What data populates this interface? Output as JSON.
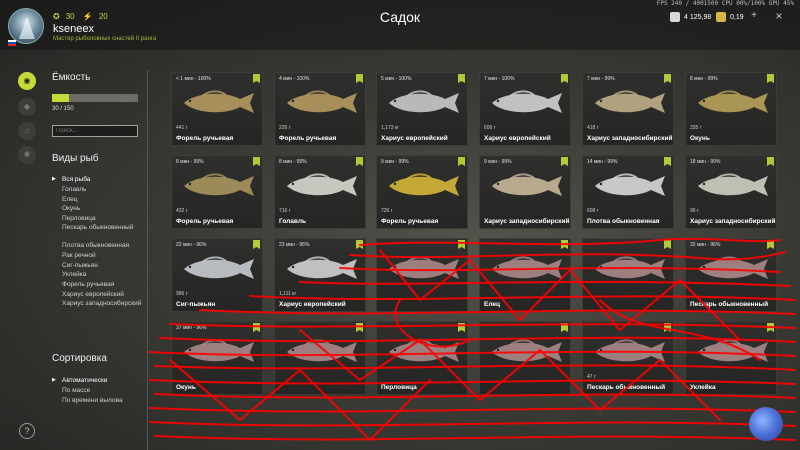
{
  "fps_overlay": "FPS 240 / 4001500 CPU 00%/100% GPU 45%",
  "user": {
    "level": "30",
    "rank": "20",
    "name": "kseneex",
    "title": "Мастер рыболовных снастей II ранга"
  },
  "page": {
    "title": "Садок"
  },
  "currency": {
    "silver": "4 125,98",
    "gold": "0,19",
    "plus": "+",
    "close": "×"
  },
  "capacity": {
    "title": "Ёмкость",
    "text": "30 / 150",
    "fill": 0.2
  },
  "search": {
    "placeholder": "Поиск..."
  },
  "species": {
    "title": "Виды рыб",
    "items": [
      "Вся рыба",
      "Голавль",
      "Елец",
      "Окунь",
      "Перловица",
      "Пескарь обыкновенный",
      "Плотва обыкновенная",
      "Рак речной",
      "Сиг-пыжьян",
      "Уклейка",
      "Форель ручьевая",
      "Хариус европейский",
      "Хариус западносибирский"
    ]
  },
  "sorting": {
    "title": "Сортировка",
    "items": [
      "Автоматически",
      "По массе",
      "По времени вылова"
    ]
  },
  "icons": {
    "rail": [
      "fish-keepnet-icon",
      "fish-icon",
      "home-icon",
      "tools-icon"
    ],
    "help": "?"
  },
  "colors": {
    "accent": "#c7d936",
    "scribble": "#ff0000"
  },
  "fish_cards": [
    {
      "tag": "< 1 мин - 100%",
      "weight": "441 г",
      "name": "Форель ручьевая",
      "color": "#b59a62"
    },
    {
      "tag": "4 мин - 100%",
      "weight": "226 г",
      "name": "Форель ручьевая",
      "color": "#b59a62"
    },
    {
      "tag": "5 мин - 100%",
      "weight": "1,173 кг",
      "name": "Хариус европейский",
      "color": "#c9c9c9"
    },
    {
      "tag": "7 мин - 100%",
      "weight": "606 г",
      "name": "Хариус европейский",
      "color": "#d2d2d2"
    },
    {
      "tag": "7 мин - 99%",
      "weight": "418 г",
      "name": "Хариус западносибирский",
      "color": "#bfae88"
    },
    {
      "tag": "8 мин - 99%",
      "weight": "335 г",
      "name": "Окунь",
      "color": "#b7a25a"
    },
    {
      "tag": "8 мин - 99%",
      "weight": "432 г",
      "name": "Форель ручьевая",
      "color": "#a8955d"
    },
    {
      "tag": "8 мин - 99%",
      "weight": "716 г",
      "name": "Голавль",
      "color": "#d8d8d0"
    },
    {
      "tag": "9 мин - 99%",
      "weight": "726 г",
      "name": "Форель ручьевая",
      "color": "#d4b63a"
    },
    {
      "tag": "9 мин - 99%",
      "weight": "",
      "name": "Хариус западносибирский",
      "color": "#c9b89a"
    },
    {
      "tag": "14 мин - 99%",
      "weight": "608 г",
      "name": "Плотва обыкновенная",
      "color": "#d8d8d8"
    },
    {
      "tag": "18 мин - 99%",
      "weight": "96 г",
      "name": "Хариус западносибирский",
      "color": "#cfcfc2"
    },
    {
      "tag": "22 мин - 96%",
      "weight": "986 г",
      "name": "Сиг-пыжьян",
      "color": "#c8ccd2"
    },
    {
      "tag": "23 мин - 96%",
      "weight": "1,111 кг",
      "name": "Хариус европейский",
      "color": "#d0d0d0"
    },
    {
      "tag": "",
      "weight": "",
      "name": "",
      "color": "#a88"
    },
    {
      "tag": "",
      "weight": "",
      "name": "Елец",
      "color": "#a88"
    },
    {
      "tag": "",
      "weight": "",
      "name": "",
      "color": "#a88"
    },
    {
      "tag": "32 мин - 96%",
      "weight": "",
      "name": "Пескарь обыкновенный",
      "color": "#a88"
    },
    {
      "tag": "37 мин - 96%",
      "weight": "",
      "name": "Окунь",
      "color": "#a88"
    },
    {
      "tag": "",
      "weight": "",
      "name": "",
      "color": "#a88"
    },
    {
      "tag": "",
      "weight": "",
      "name": "Перловица",
      "color": "#a88"
    },
    {
      "tag": "",
      "weight": "",
      "name": "",
      "color": "#a88"
    },
    {
      "tag": "",
      "weight": "47 г",
      "name": "Пескарь обыкновенный",
      "color": "#a88"
    },
    {
      "tag": "",
      "weight": "",
      "name": "Уклейка",
      "color": "#a88"
    }
  ]
}
